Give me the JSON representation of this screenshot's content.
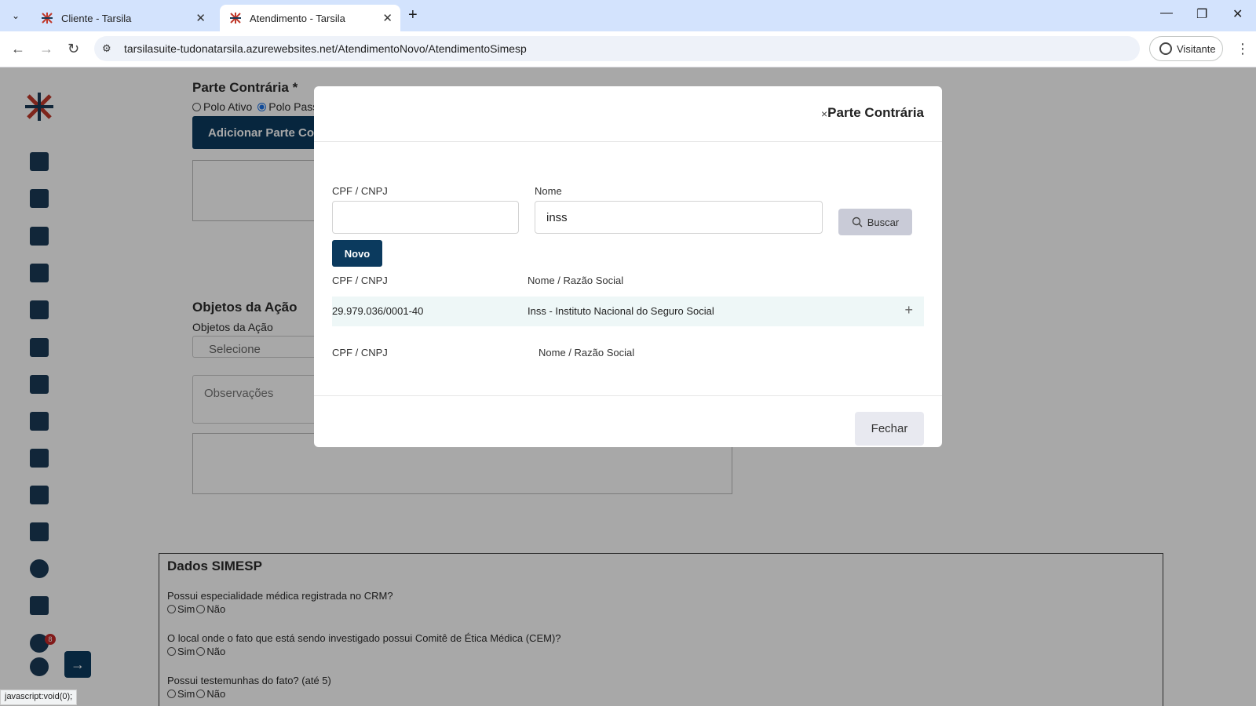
{
  "browser": {
    "tabs": [
      {
        "title": "Cliente - Tarsila"
      },
      {
        "title": "Atendimento - Tarsila"
      }
    ],
    "url": "tarsilasuite-tudonatarsila.azurewebsites.net/AtendimentoNovo/AtendimentoSimesp",
    "profile_label": "Visitante"
  },
  "sidebar": {
    "notification_count": "8"
  },
  "background_form": {
    "parte_heading": "Parte Contrária",
    "required_mark": "*",
    "polo_ativo": "Polo Ativo",
    "polo_passivo": "Polo Pass",
    "add_parte_button": "Adicionar Parte Con",
    "objetos_heading": "Objetos da Ação",
    "objetos_label": "Objetos da Ação",
    "objetos_select": "Selecione",
    "observacoes_placeholder": "Observações",
    "simesp": {
      "heading": "Dados SIMESP",
      "questions": [
        {
          "text": "Possui especialidade médica registrada no CRM?"
        },
        {
          "text": "O local onde o fato que está sendo investigado possui Comitê de Ética Médica (CEM)?"
        },
        {
          "text": "Possui testemunhas do fato? (até 5)"
        }
      ],
      "yes": "Sim",
      "no": "Não"
    }
  },
  "modal": {
    "title": "Parte Contrária",
    "close_glyph": "×",
    "cpf_label": "CPF / CNPJ",
    "cpf_value": "",
    "nome_label": "Nome",
    "nome_value": "inss",
    "buscar_button": "Buscar",
    "novo_button": "Novo",
    "results_headers": {
      "cpf": "CPF / CNPJ",
      "nome": "Nome / Razão Social"
    },
    "results": [
      {
        "cpf": "29.979.036/0001-40",
        "nome": "Inss - Instituto Nacional do Seguro Social"
      }
    ],
    "selected_headers": {
      "cpf": "CPF / CNPJ",
      "nome": "Nome / Razão Social"
    },
    "fechar_button": "Fechar"
  },
  "status_bar": "javascript:void(0);",
  "colors": {
    "primary": "#0b3a5e",
    "row_highlight": "#eef7f7",
    "overlay": "rgba(0,0,0,0.34)"
  }
}
